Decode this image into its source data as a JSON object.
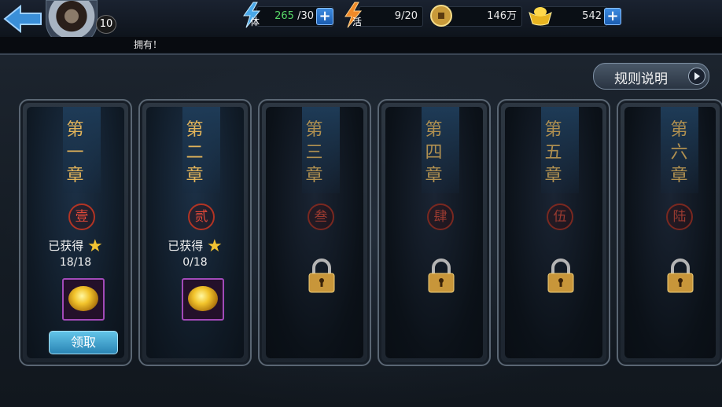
{
  "header": {
    "level": "10",
    "stamina": {
      "current": "265",
      "max": " /30"
    },
    "vigor": {
      "current": "9",
      "max": "/20"
    },
    "coins": "146万",
    "ingots": "542",
    "stamina_label": "体",
    "vigor_label": "活"
  },
  "message": "拥有！",
  "rules_label": "规则说明",
  "chapters": [
    {
      "title": [
        "第",
        "一",
        "章"
      ],
      "seal": "壹",
      "obtained_label": "已获得",
      "count": "18/18",
      "claim_label": "领取",
      "locked": false
    },
    {
      "title": [
        "第",
        "二",
        "章"
      ],
      "seal": "贰",
      "obtained_label": "已获得",
      "count": "0/18",
      "locked": false
    },
    {
      "title": [
        "第",
        "三",
        "章"
      ],
      "seal": "叁",
      "locked": true
    },
    {
      "title": [
        "第",
        "四",
        "章"
      ],
      "seal": "肆",
      "locked": true
    },
    {
      "title": [
        "第",
        "五",
        "章"
      ],
      "seal": "伍",
      "locked": true
    },
    {
      "title": [
        "第",
        "六",
        "章"
      ],
      "seal": "陆",
      "locked": true
    }
  ],
  "colors": {
    "accent_gold": "#e1b35a",
    "seal_red": "#b23424",
    "claim_blue": "#2a84b4",
    "stamina_green": "#58d868"
  },
  "icons": {
    "back": "back-arrow-icon",
    "stamina": "lightning-icon",
    "vigor": "flame-lightning-icon",
    "coin": "coin-icon",
    "ingot": "gold-ingot-icon",
    "star": "star-icon",
    "lock": "padlock-icon",
    "reward": "gold-treasure-icon"
  }
}
